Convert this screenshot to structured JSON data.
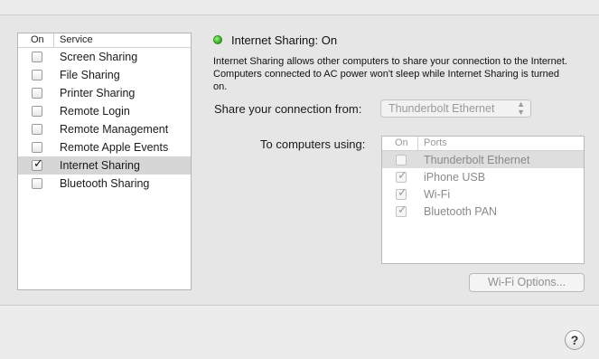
{
  "services": {
    "header_on": "On",
    "header_service": "Service",
    "items": [
      {
        "label": "Screen Sharing",
        "checked": false,
        "selected": false
      },
      {
        "label": "File Sharing",
        "checked": false,
        "selected": false
      },
      {
        "label": "Printer Sharing",
        "checked": false,
        "selected": false
      },
      {
        "label": "Remote Login",
        "checked": false,
        "selected": false
      },
      {
        "label": "Remote Management",
        "checked": false,
        "selected": false
      },
      {
        "label": "Remote Apple Events",
        "checked": false,
        "selected": false
      },
      {
        "label": "Internet Sharing",
        "checked": true,
        "selected": true
      },
      {
        "label": "Bluetooth Sharing",
        "checked": false,
        "selected": false
      }
    ]
  },
  "status": {
    "title": "Internet Sharing: On",
    "color": "#2fa51a",
    "description": "Internet Sharing allows other computers to share your connection to the Internet. Computers connected to AC power won't sleep while Internet Sharing is turned on."
  },
  "share_from": {
    "label": "Share your connection from:",
    "value": "Thunderbolt Ethernet"
  },
  "to_computers": {
    "label": "To computers using:",
    "header_on": "On",
    "header_ports": "Ports",
    "ports": [
      {
        "label": "Thunderbolt Ethernet",
        "checked": false,
        "selected": true
      },
      {
        "label": "iPhone USB",
        "checked": true,
        "selected": false
      },
      {
        "label": "Wi-Fi",
        "checked": true,
        "selected": false
      },
      {
        "label": "Bluetooth PAN",
        "checked": true,
        "selected": false
      }
    ]
  },
  "buttons": {
    "wifi_options": "Wi-Fi Options...",
    "help": "?"
  }
}
